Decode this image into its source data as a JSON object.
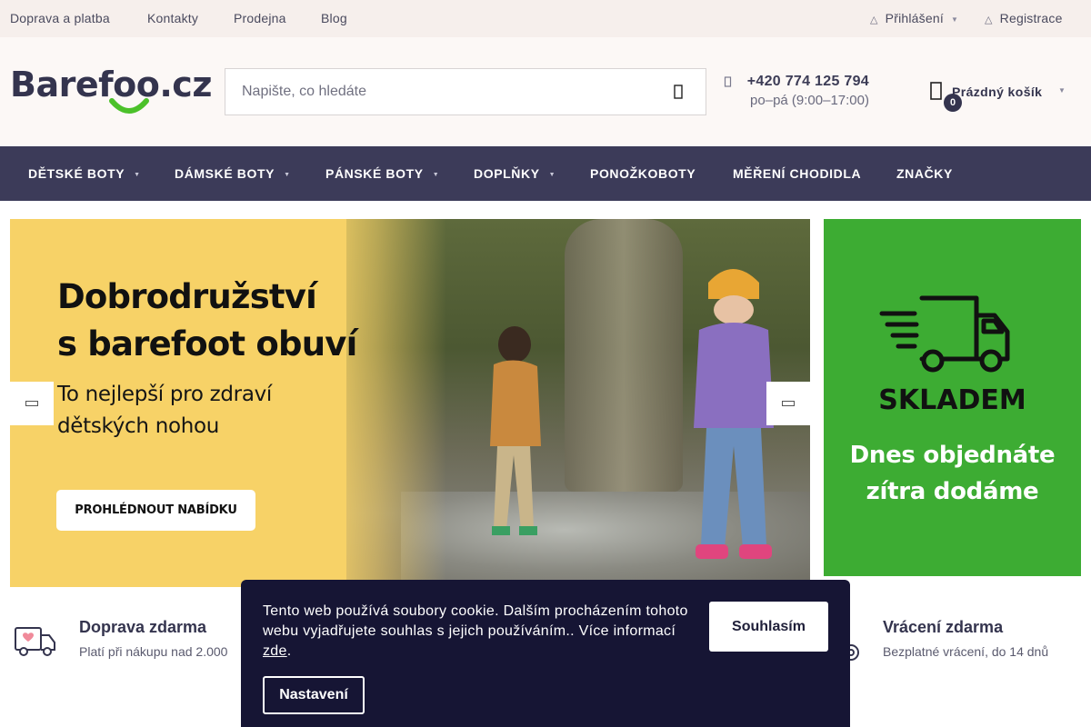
{
  "topbar": {
    "links": [
      "Doprava a platba",
      "Kontakty",
      "Prodejna",
      "Blog"
    ],
    "login": "Přihlášení",
    "register": "Registrace"
  },
  "header": {
    "logo": "Barefoo.cz",
    "search_placeholder": "Napište, co hledáte",
    "phone": "+420 774 125 794",
    "hours": "po–pá (9:00–17:00)",
    "cart_label": "Prázdný košík",
    "cart_count": "0"
  },
  "nav": {
    "items": [
      "DĚTSKÉ BOTY",
      "DÁMSKÉ BOTY",
      "PÁNSKÉ BOTY",
      "DOPLŇKY",
      "PONOŽKOBOTY",
      "MĚŘENÍ CHODIDLA",
      "ZNAČKY"
    ]
  },
  "hero": {
    "title_line1": "Dobrodružství",
    "title_line2": "s barefoot obuví",
    "sub_line1": "To nejlepší pro zdraví",
    "sub_line2": "dětských nohou",
    "cta": "PROHLÉDNOUT NABÍDKU"
  },
  "side_banner": {
    "title": "SKLADEM",
    "line1": "Dnes objednáte",
    "line2": "zítra dodáme"
  },
  "benefits": [
    {
      "title": "Doprava zdarma",
      "sub": "Platí při nákupu nad 2.000"
    },
    {
      "title": "Vrácení zdarma",
      "sub": "Bezplatné vrácení, do 14 dnů"
    }
  ],
  "cookie": {
    "text": "Tento web používá soubory cookie. Dalším procházením tohoto webu vyjadřujete souhlas s jejich používáním.. Více informací ",
    "link": "zde",
    "text_end": ".",
    "agree": "Souhlasím",
    "settings": "Nastavení"
  },
  "colors": {
    "nav_bg": "#3c3b59",
    "hero_yellow": "#f7d267",
    "side_green": "#3dac33",
    "cookie_bg": "#161534",
    "logo_smile": "#4cc12a"
  }
}
